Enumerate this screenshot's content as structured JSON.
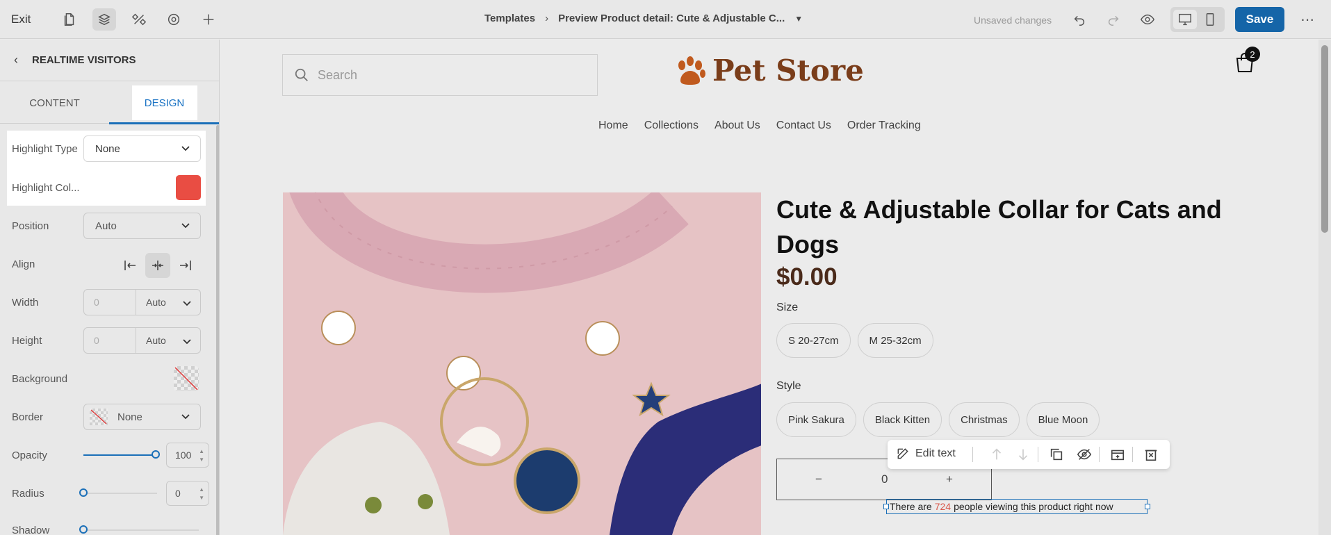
{
  "topbar": {
    "exit_label": "Exit",
    "breadcrumb_root": "Templates",
    "breadcrumb_page": "Preview Product detail: Cute & Adjustable C...",
    "unsaved": "Unsaved changes",
    "save_label": "Save",
    "icons": [
      "page-icon",
      "layers-icon",
      "components-icon",
      "settings-icon",
      "plus-icon",
      "undo-icon",
      "redo-icon",
      "preview-icon",
      "desktop-icon",
      "mobile-icon",
      "more-icon"
    ]
  },
  "panel": {
    "title": "REALTIME VISITORS",
    "tabs": {
      "content": "CONTENT",
      "design": "DESIGN"
    },
    "highlight_type": {
      "label": "Highlight Type",
      "value": "None"
    },
    "highlight_color": {
      "label": "Highlight Col...",
      "value": "#e94d43"
    },
    "position": {
      "label": "Position",
      "value": "Auto"
    },
    "align": {
      "label": "Align"
    },
    "width": {
      "label": "Width",
      "value": "0",
      "unit": "Auto"
    },
    "height": {
      "label": "Height",
      "value": "0",
      "unit": "Auto"
    },
    "background": {
      "label": "Background"
    },
    "border": {
      "label": "Border",
      "value": "None"
    },
    "opacity": {
      "label": "Opacity",
      "value": "100"
    },
    "radius": {
      "label": "Radius",
      "value": "0"
    },
    "shadow": {
      "label": "Shadow"
    }
  },
  "store": {
    "search_placeholder": "Search",
    "logo_text": "Pet Store",
    "cart_count": "2",
    "nav": [
      "Home",
      "Collections",
      "About Us",
      "Contact Us",
      "Order Tracking"
    ],
    "product": {
      "title": "Cute & Adjustable Collar for Cats and Dogs",
      "price": "$0.00",
      "size_label": "Size",
      "sizes": [
        "S 20-27cm",
        "M 25-32cm"
      ],
      "style_label": "Style",
      "styles": [
        "Pink Sakura",
        "Black Kitten",
        "Christmas",
        "Blue Moon"
      ],
      "qty_minus": "−",
      "qty_value": "0",
      "qty_plus": "+"
    },
    "toolbar": {
      "edit_text": "Edit text"
    },
    "visitors": {
      "prefix": "There are",
      "count": "724",
      "suffix": "people viewing this product right now"
    }
  },
  "colors": {
    "accent": "#1565a8",
    "brand_brown": "#7a3d1a",
    "highlight": "#e94d43"
  }
}
